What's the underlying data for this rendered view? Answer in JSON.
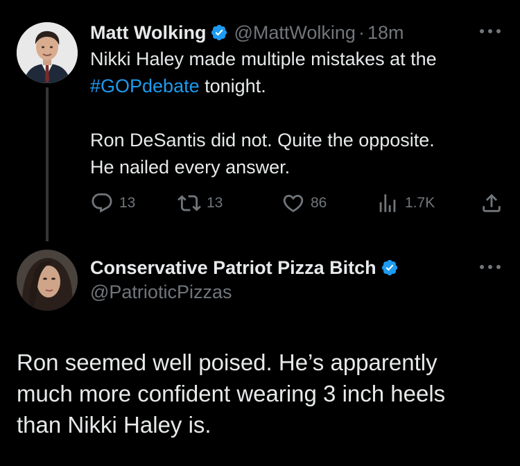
{
  "thread": {
    "parent_tweet": {
      "author": {
        "display_name": "Matt Wolking",
        "verified_icon": "verified-badge-icon",
        "handle": "@MattWolking",
        "separator": "·",
        "time": "18m"
      },
      "text": {
        "line1": "Nikki Haley made multiple mistakes at the",
        "hashtag": "#GOPdebate",
        "line2_rest": " tonight.",
        "line3": "Ron DeSantis did not. Quite the opposite.",
        "line4": "He nailed every answer."
      },
      "actions": {
        "replies": "13",
        "retweets": "13",
        "likes": "86",
        "views": "1.7K"
      }
    },
    "reply_tweet": {
      "author": {
        "display_name": "Conservative Patriot Pizza Bitch",
        "verified_icon": "verified-badge-icon",
        "handle": "@PatrioticPizzas"
      },
      "text": {
        "line1": "Ron seemed well poised. He’s apparently",
        "line2": "much more confident wearing 3 inch heels",
        "line3": "than Nikki Haley is."
      }
    }
  },
  "colors": {
    "background": "#000000",
    "text": "#e7e9ea",
    "muted": "#71767b",
    "link": "#1d9bf0",
    "verified": "#1d9bf0",
    "thread_line": "#333639"
  }
}
